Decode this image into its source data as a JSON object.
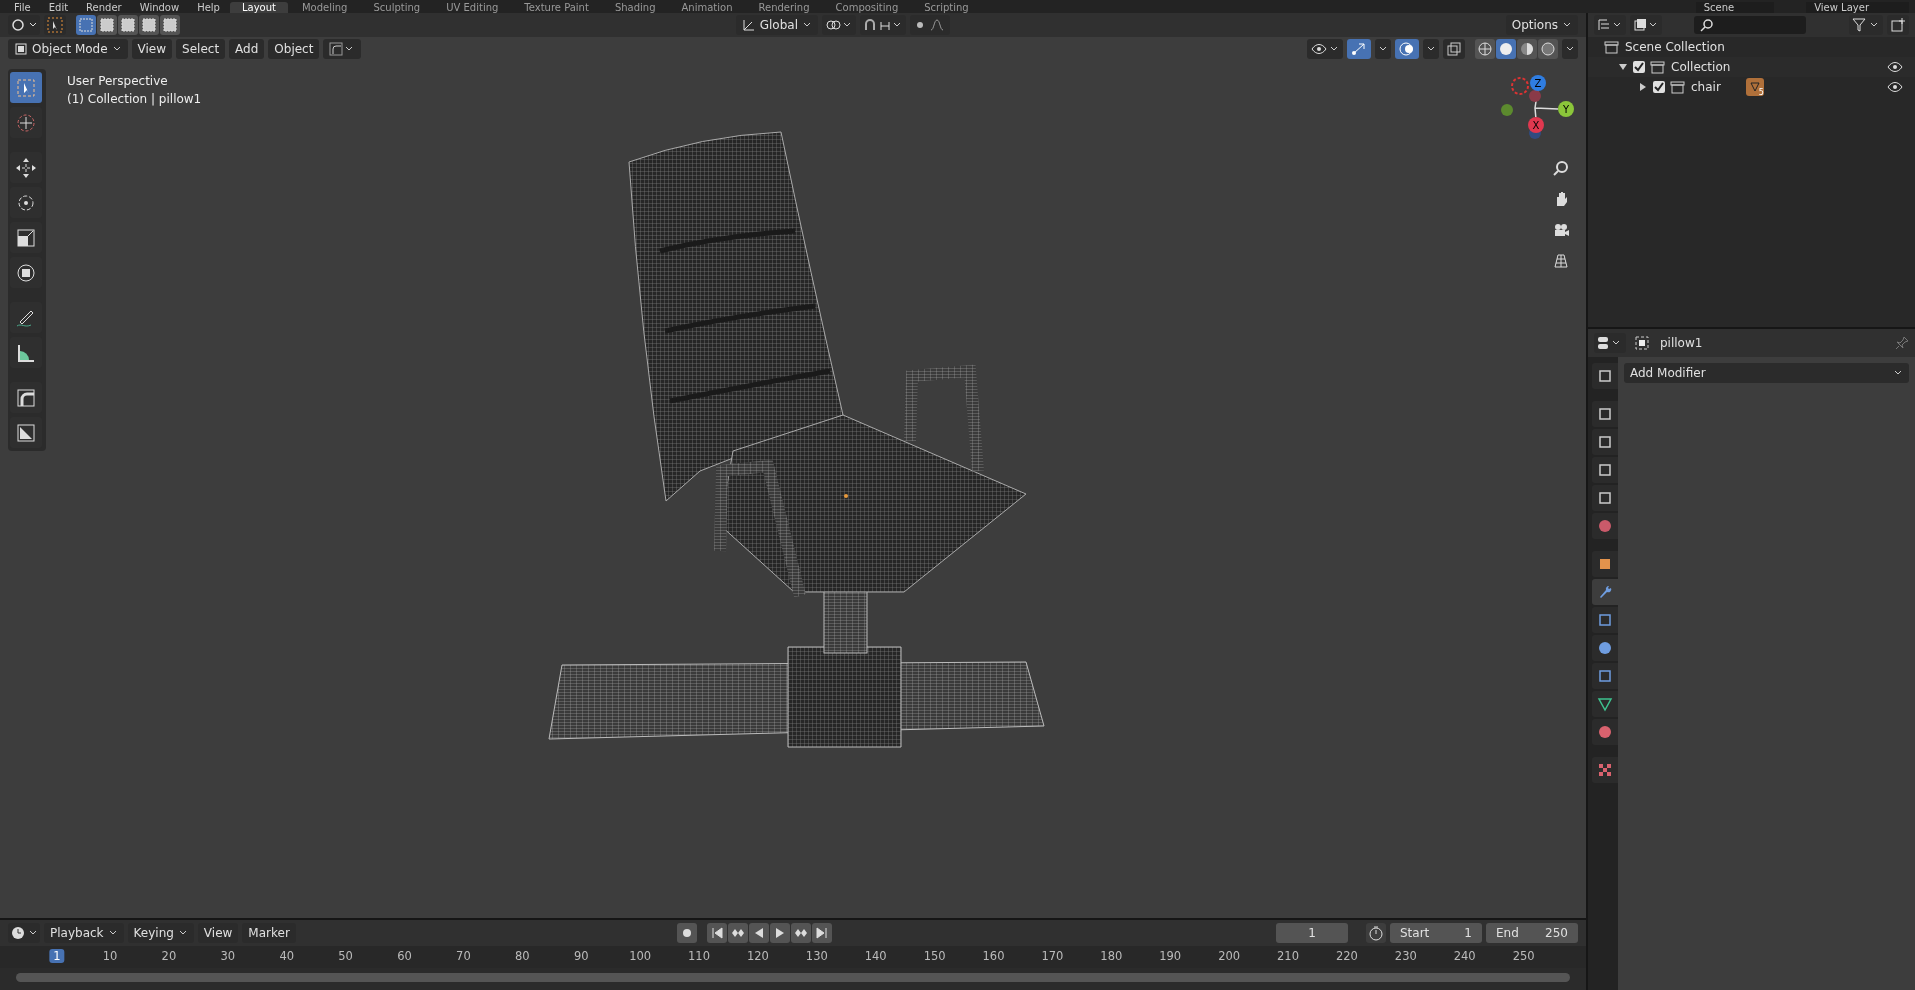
{
  "top_bar": {
    "menus": [
      "File",
      "Edit",
      "Render",
      "Window",
      "Help"
    ],
    "workspaces": [
      {
        "label": "Layout",
        "selected": true
      },
      {
        "label": "Modeling",
        "selected": false
      },
      {
        "label": "Sculpting",
        "selected": false
      },
      {
        "label": "UV Editing",
        "selected": false
      },
      {
        "label": "Texture Paint",
        "selected": false
      },
      {
        "label": "Shading",
        "selected": false
      },
      {
        "label": "Animation",
        "selected": false
      },
      {
        "label": "Rendering",
        "selected": false
      },
      {
        "label": "Compositing",
        "selected": false
      },
      {
        "label": "Scripting",
        "selected": false
      }
    ],
    "scene": "Scene",
    "view_layer": "View Layer"
  },
  "viewport": {
    "header": {
      "select_modes": [
        {
          "selected": true
        },
        {
          "selected": false
        },
        {
          "selected": false
        },
        {
          "selected": false
        },
        {
          "selected": false
        }
      ],
      "transform_orientation": "Global",
      "options": "Options"
    },
    "menu": {
      "mode": "Object Mode",
      "items": [
        "View",
        "Select",
        "Add",
        "Object"
      ]
    },
    "shading": [
      {
        "kind": "wireframe",
        "selected": false
      },
      {
        "kind": "solid",
        "selected": true
      },
      {
        "kind": "material",
        "selected": false
      },
      {
        "kind": "rendered",
        "selected": false
      }
    ],
    "overlay_text": [
      "User Perspective",
      "(1) Collection | pillow1"
    ],
    "tools": [
      {
        "kind": "select",
        "selected": true
      },
      {
        "kind": "cursor",
        "selected": false
      },
      {
        "kind": "move",
        "selected": false
      },
      {
        "kind": "rotate",
        "selected": false
      },
      {
        "kind": "scale",
        "selected": false
      },
      {
        "kind": "transform",
        "selected": false
      },
      {
        "kind": "annotate",
        "selected": false
      },
      {
        "kind": "measure",
        "selected": false
      },
      {
        "kind": "bevel",
        "selected": false
      },
      {
        "kind": "face",
        "selected": false
      }
    ],
    "gizmo": {
      "x": "X",
      "y": "Y",
      "z": "Z"
    }
  },
  "outliner": {
    "tree": [
      {
        "label": "Scene Collection",
        "children": [
          {
            "label": "Collection",
            "expanded": true,
            "checked": true,
            "children": [
              {
                "label": "chair",
                "expanded": false,
                "checked": true,
                "badge": "5"
              }
            ]
          }
        ]
      }
    ]
  },
  "properties": {
    "object": "pillow1",
    "add_modifier": "Add Modifier",
    "tabs": [
      {
        "kind": "tool",
        "selected": false
      },
      {
        "kind": "render",
        "selected": false
      },
      {
        "kind": "output",
        "selected": false
      },
      {
        "kind": "view-layer",
        "selected": false
      },
      {
        "kind": "scene",
        "selected": false
      },
      {
        "kind": "world",
        "selected": false
      },
      {
        "kind": "object",
        "selected": false
      },
      {
        "kind": "modifier",
        "selected": true
      },
      {
        "kind": "particles",
        "selected": false
      },
      {
        "kind": "physics",
        "selected": false
      },
      {
        "kind": "constraints",
        "selected": false
      },
      {
        "kind": "data",
        "selected": false
      },
      {
        "kind": "material",
        "selected": false
      },
      {
        "kind": "texture",
        "selected": false
      }
    ]
  },
  "timeline": {
    "menus": [
      "Playback",
      "Keying",
      "View",
      "Marker"
    ],
    "current_frame": "1",
    "start_label": "Start",
    "start": "1",
    "end_label": "End",
    "end": "250",
    "ruler": [
      {
        "label": "1",
        "selected": true
      },
      {
        "label": "10",
        "selected": false
      },
      {
        "label": "20",
        "selected": false
      },
      {
        "label": "30",
        "selected": false
      },
      {
        "label": "40",
        "selected": false
      },
      {
        "label": "50",
        "selected": false
      },
      {
        "label": "60",
        "selected": false
      },
      {
        "label": "70",
        "selected": false
      },
      {
        "label": "80",
        "selected": false
      },
      {
        "label": "90",
        "selected": false
      },
      {
        "label": "100",
        "selected": false
      },
      {
        "label": "110",
        "selected": false
      },
      {
        "label": "120",
        "selected": false
      },
      {
        "label": "130",
        "selected": false
      },
      {
        "label": "140",
        "selected": false
      },
      {
        "label": "150",
        "selected": false
      },
      {
        "label": "160",
        "selected": false
      },
      {
        "label": "170",
        "selected": false
      },
      {
        "label": "180",
        "selected": false
      },
      {
        "label": "190",
        "selected": false
      },
      {
        "label": "200",
        "selected": false
      },
      {
        "label": "210",
        "selected": false
      },
      {
        "label": "220",
        "selected": false
      },
      {
        "label": "230",
        "selected": false
      },
      {
        "label": "240",
        "selected": false
      },
      {
        "label": "250",
        "selected": false
      }
    ]
  }
}
